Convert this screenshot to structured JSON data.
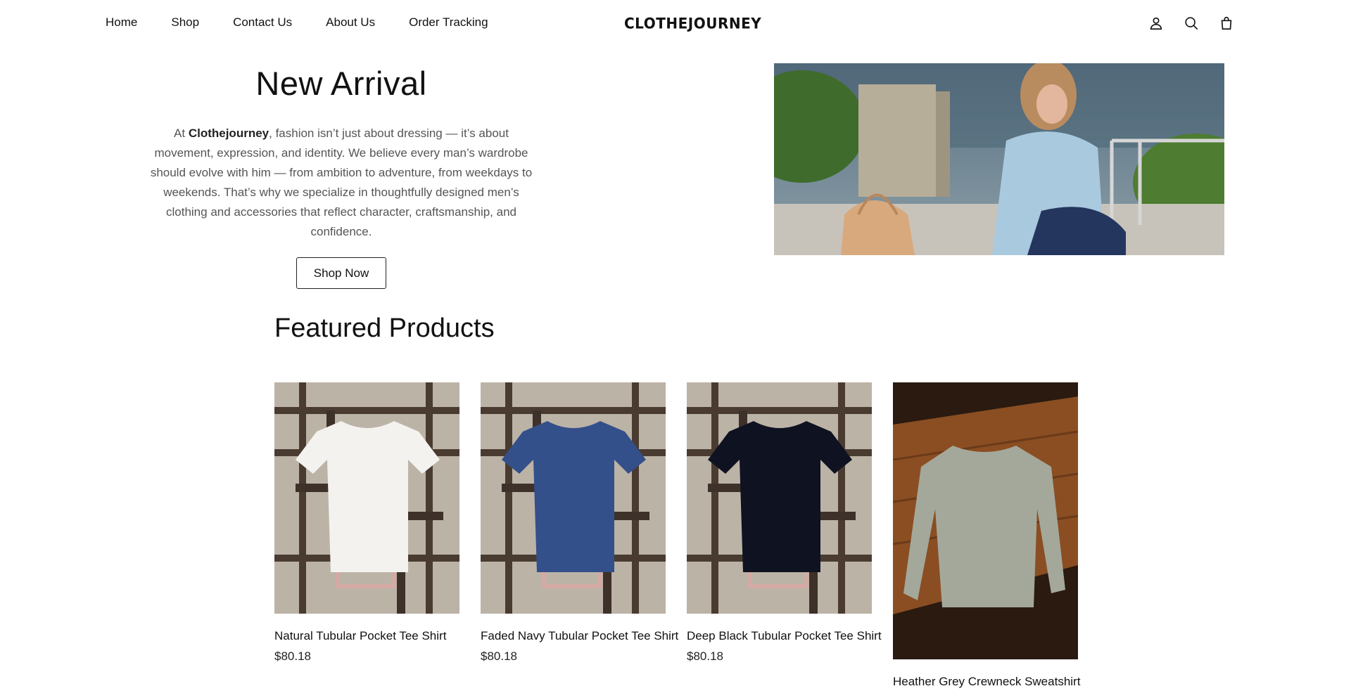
{
  "nav": {
    "items": [
      "Home",
      "Shop",
      "Contact Us",
      "About Us",
      "Order Tracking"
    ]
  },
  "logo": "CLOTHEJOURNEY",
  "header_icons": [
    "account-icon",
    "search-icon",
    "cart-icon"
  ],
  "hero": {
    "title": "New Arrival",
    "text_prefix": "At ",
    "brand": "Clothejourney",
    "text_suffix": ", fashion isn’t just about dressing — it’s about movement, expression, and identity. We believe every man’s wardrobe should evolve with him — from ambition to adventure, from weekdays to weekends. That’s why we specialize in thoughtfully designed men’s clothing and accessories that reflect character, craftsmanship, and confidence.",
    "button": "Shop Now"
  },
  "featured": {
    "title": "Featured Products",
    "products": [
      {
        "name": "Natural Tubular Pocket Tee Shirt",
        "price": "$80.18",
        "shirt_color": "#f3f2ee"
      },
      {
        "name": "Faded Navy Tubular Pocket Tee Shirt",
        "price": "$80.18",
        "shirt_color": "#34508a"
      },
      {
        "name": "Deep Black Tubular Pocket Tee Shirt",
        "price": "$80.18",
        "shirt_color": "#0f1220"
      },
      {
        "name": "Heather Grey Crewneck Sweatshirt",
        "price": "",
        "shirt_color": "#a4a89b"
      }
    ]
  }
}
